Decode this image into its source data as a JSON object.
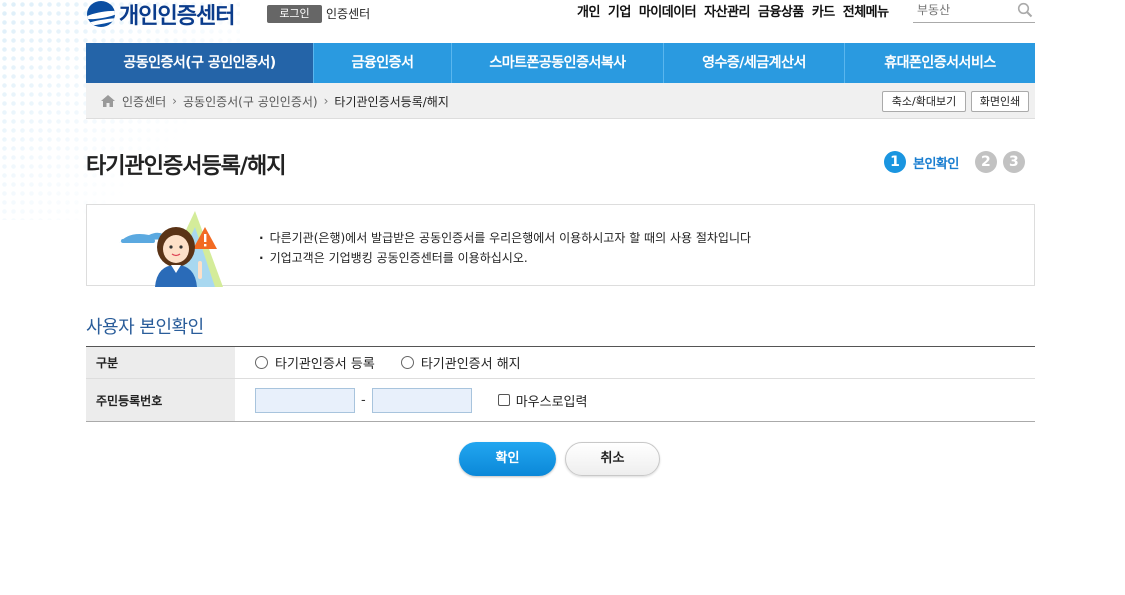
{
  "header": {
    "logo_text": "개인인증센터",
    "login_label": "로그인",
    "cert_center_label": "인증센터",
    "top_menu": [
      "개인",
      "기업",
      "마이데이터",
      "자산관리",
      "금융상품",
      "카드",
      "전체메뉴"
    ],
    "search_placeholder": "부동산"
  },
  "nav": {
    "items": [
      {
        "label": "공동인증서(구 공인인증서)",
        "active": true
      },
      {
        "label": "금융인증서"
      },
      {
        "label": "스마트폰공동인증서복사"
      },
      {
        "label": "영수증/세금계산서"
      },
      {
        "label": "휴대폰인증서서비스"
      }
    ]
  },
  "breadcrumb": {
    "items": [
      "인증센터",
      "공동인증서(구 공인인증서)",
      "타기관인증서등록/해지"
    ],
    "zoom_label": "축소/확대보기",
    "print_label": "화면인쇄"
  },
  "page": {
    "title": "타기관인증서등록/해지",
    "steps": [
      {
        "number": "1",
        "label": "본인확인",
        "active": true
      },
      {
        "number": "2"
      },
      {
        "number": "3"
      }
    ]
  },
  "notice": {
    "lines": [
      "다른기관(은행)에서 발급받은 공동인증서를 우리은행에서 이용하시고자 할 때의 사용 절차입니다",
      "기업고객은 기업뱅킹 공동인증센터를 이용하십시오."
    ]
  },
  "form": {
    "section_title": "사용자 본인확인",
    "type_label": "구분",
    "option_register": "타기관인증서 등록",
    "option_cancel": "타기관인증서 해지",
    "rrn_label": "주민등록번호",
    "rrn_separator": "-",
    "mouse_input_label": "마우스로입력"
  },
  "actions": {
    "confirm_label": "확인",
    "cancel_label": "취소"
  },
  "colors": {
    "brand": "#0b3c8c",
    "nav_bg": "#2a9ae0",
    "nav_active": "#2464a8",
    "step_active": "#1a95e0"
  }
}
